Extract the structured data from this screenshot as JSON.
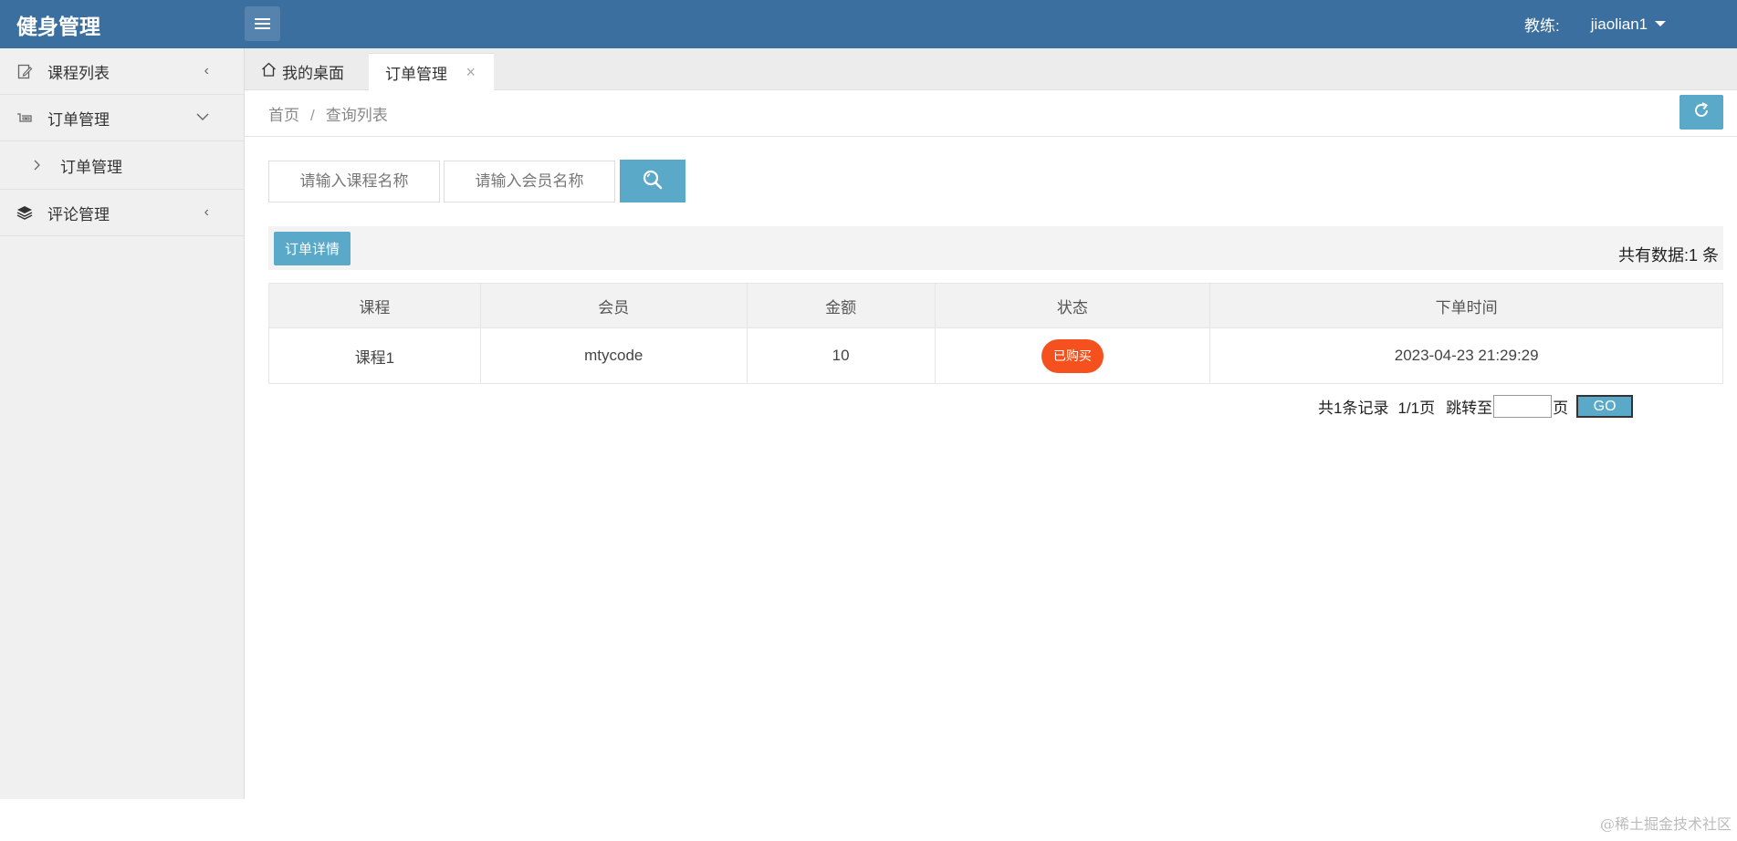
{
  "header": {
    "app_title": "健身管理",
    "role_label": "教练:",
    "username": "jiaolian1"
  },
  "sidebar": {
    "items": [
      {
        "label": "课程列表",
        "icon": "edit-document-icon",
        "arrow": "‹"
      },
      {
        "label": "订单管理",
        "icon": "cart-icon",
        "arrow": "⌄"
      },
      {
        "label": "订单管理",
        "icon": "chevron-right-icon"
      },
      {
        "label": "评论管理",
        "icon": "layers-icon",
        "arrow": "‹"
      }
    ]
  },
  "tabs": {
    "home_label": "我的桌面",
    "active_label": "订单管理",
    "close_glyph": "×"
  },
  "breadcrumb": {
    "home": "首页",
    "separator": "/",
    "current": "查询列表"
  },
  "search": {
    "course_placeholder": "请输入课程名称",
    "member_placeholder": "请输入会员名称"
  },
  "toolbar": {
    "detail_label": "订单详情",
    "count_text": "共有数据:1 条"
  },
  "table": {
    "headers": [
      "课程",
      "会员",
      "金额",
      "状态",
      "下单时间"
    ],
    "rows": [
      {
        "course": "课程1",
        "member": "mtycode",
        "amount": "10",
        "status": "已购买",
        "time": "2023-04-23 21:29:29"
      }
    ]
  },
  "pager": {
    "records": "共1条记录",
    "pages": "1/1页",
    "jump_prefix": "跳转至",
    "jump_suffix": "页",
    "go_label": "GO"
  },
  "footer": {
    "watermark": "@稀土掘金技术社区"
  },
  "colors": {
    "header_bg": "#3a6f9f",
    "accent": "#5aa9c8",
    "badge": "#f4511e"
  }
}
